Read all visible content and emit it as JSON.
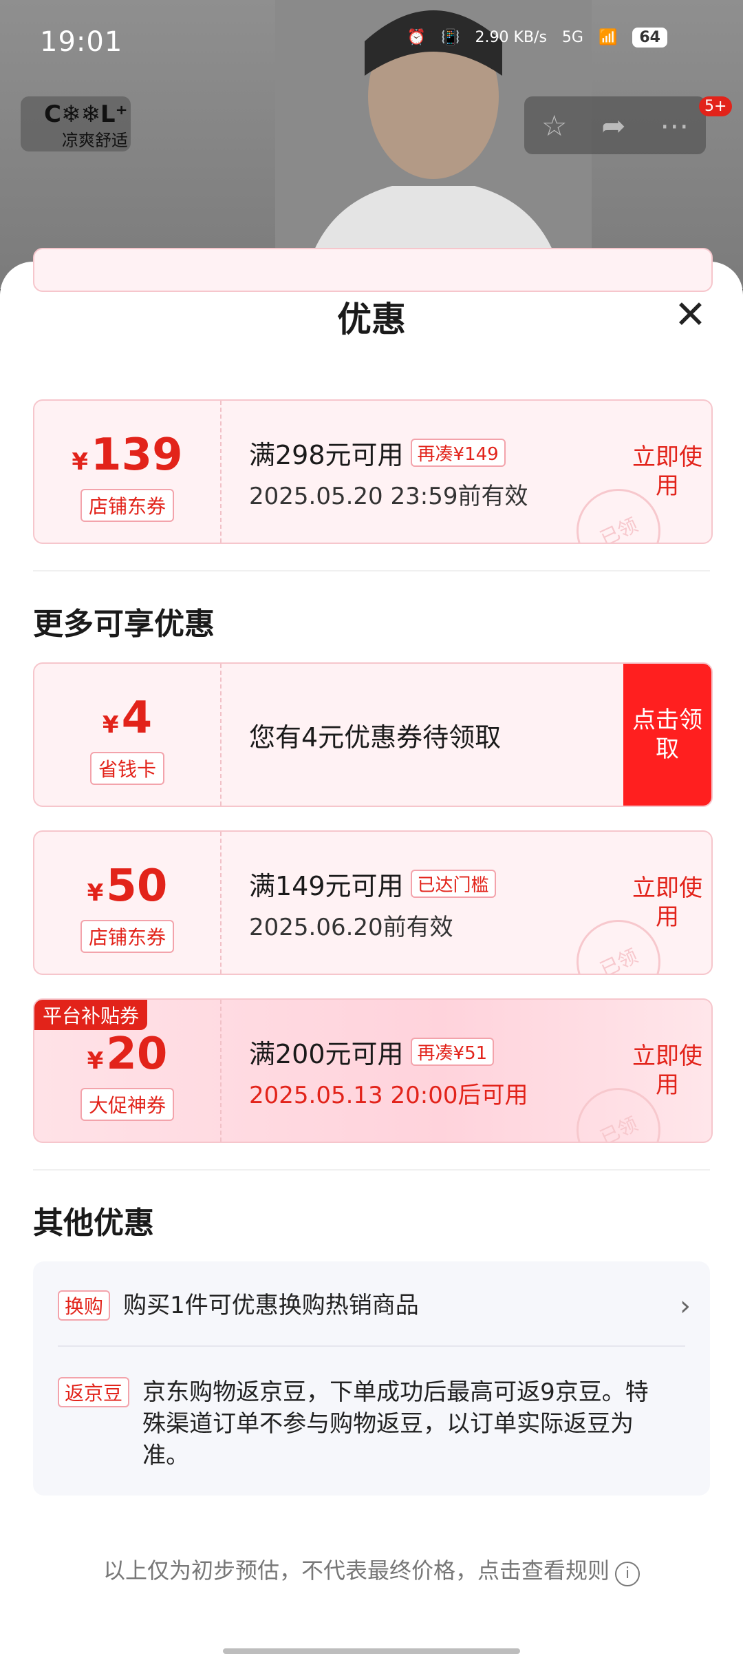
{
  "status_bar": {
    "time": "19:01",
    "net_speed": "2.90 KB/s",
    "signal": "5G",
    "battery": "64"
  },
  "brand": {
    "logo_text": "C❄❄L⁺",
    "tagline": "凉爽舒适"
  },
  "top_badge": "5+",
  "sheet": {
    "title": "优惠"
  },
  "coupons_top": [
    {
      "amount": "139",
      "currency": "¥",
      "type": "店铺东券",
      "condition": "满298元可用",
      "tag": "再凑¥149",
      "validity": "2025.05.20 23:59前有效",
      "action": "立即使用",
      "stamp": "已领"
    }
  ],
  "more": {
    "title": "更多可享优惠",
    "coupons": [
      {
        "amount": "4",
        "currency": "¥",
        "type": "省钱卡",
        "condition": "您有4元优惠券待领取",
        "action": "点击领取"
      },
      {
        "amount": "50",
        "currency": "¥",
        "type": "店铺东券",
        "condition": "满149元可用",
        "tag": "已达门槛",
        "validity": "2025.06.20前有效",
        "action": "立即使用",
        "stamp": "已领"
      },
      {
        "amount": "20",
        "currency": "¥",
        "type": "大促神券",
        "ribbon": "平台补贴券",
        "condition": "满200元可用",
        "tag": "再凑¥51",
        "validity": "2025.05.13 20:00后可用",
        "action": "立即使用",
        "stamp": "已领"
      }
    ]
  },
  "other": {
    "title": "其他优惠",
    "items": [
      {
        "tag": "换购",
        "text": "购买1件可优惠换购热销商品"
      },
      {
        "tag": "返京豆",
        "text": "京东购物返京豆，下单成功后最高可返9京豆。特殊渠道订单不参与购物返豆，以订单实际返豆为准。"
      }
    ]
  },
  "footer": {
    "text": "以上仅为初步预估，不代表最终价格，点击查看规则",
    "info_icon": "i"
  }
}
